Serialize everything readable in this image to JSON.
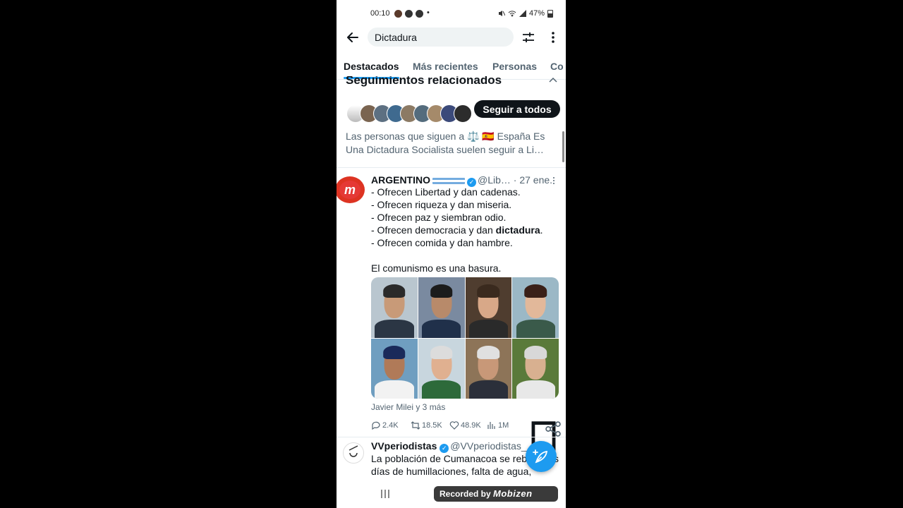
{
  "status_bar": {
    "time": "00:10",
    "dot": "•",
    "battery": "47%"
  },
  "search": {
    "query": "Dictadura"
  },
  "tabs": [
    {
      "label": "Destacados"
    },
    {
      "label": "Más recientes"
    },
    {
      "label": "Personas"
    },
    {
      "label": "Co"
    }
  ],
  "related": {
    "heading": "Seguimientos relacionados",
    "follow_all_label": "Seguir a todos",
    "description": "Las personas que siguen a ⚖️ 🇪🇸 España Es Una Dictadura Socialista suelen seguir a Li…"
  },
  "tweet1": {
    "name": "ARGENTINO",
    "handle": "@Lib…",
    "date": "· 27 ene.",
    "lines": [
      "- Ofrecen Libertad y dan cadenas.",
      "- Ofrecen riqueza y dan miseria.",
      "- Ofrecen paz y siembran odio.",
      "- Ofrecen democracia y dan ",
      "- Ofrecen comida y dan hambre.",
      "",
      "El comunismo es una basura."
    ],
    "highlight": "dictadura",
    "highlight_suffix": ".",
    "attribution": "Javier Milei y 3 más",
    "replies": "2.4K",
    "retweets": "18.5K",
    "likes": "48.9K",
    "views": "1M"
  },
  "tweet2": {
    "name": "VVperiodistas",
    "handle": "@VVperiodistas_",
    "lines": [
      "La población de Cumanacoa se reb",
      "días de humillaciones, falta de agua,"
    ],
    "line_end": "s"
  },
  "recorder": {
    "prefix": "Recorded by",
    "brand": "Mobizen"
  },
  "colors": {
    "accent": "#1d9bf0",
    "text": "#0f1419",
    "muted": "#536471"
  }
}
